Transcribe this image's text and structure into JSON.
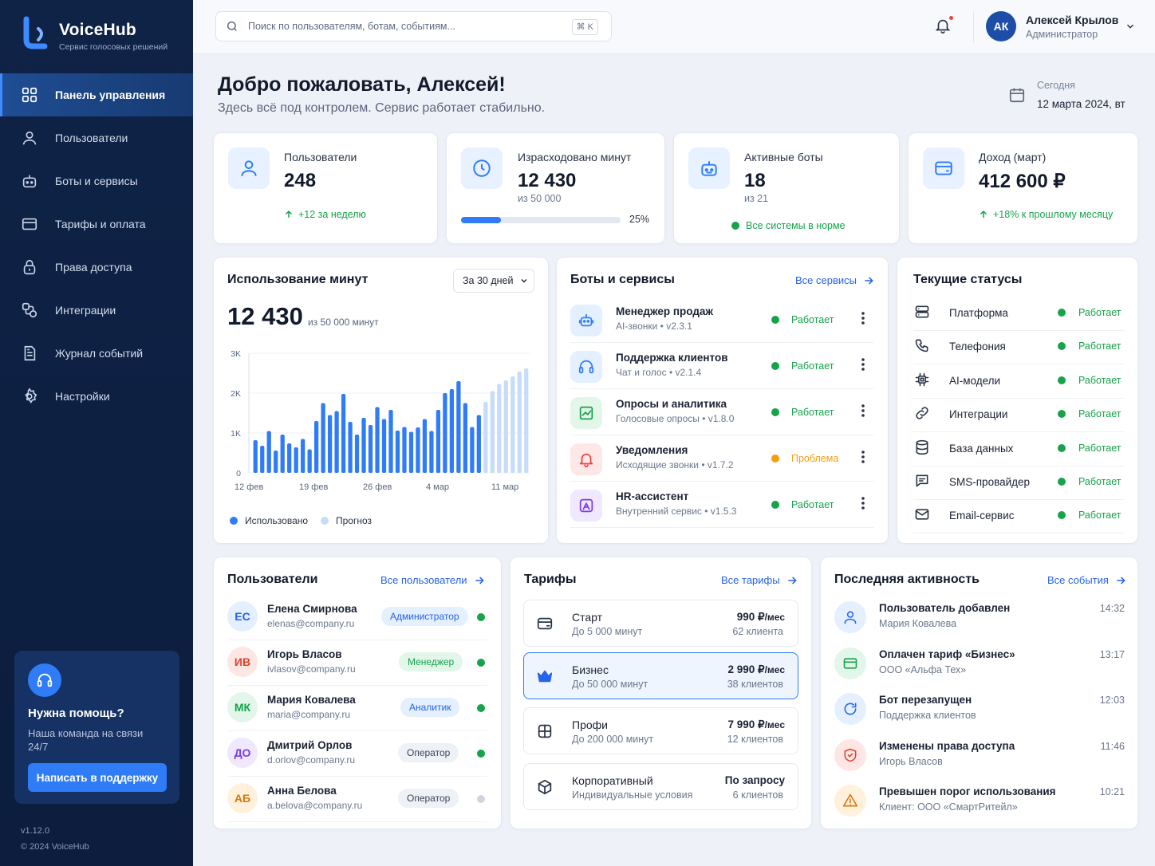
{
  "brand": {
    "name": "VoiceHub",
    "tagline": "Сервис голосовых решений"
  },
  "sidebar": {
    "items": [
      {
        "label": "Панель управления",
        "icon": "dashboard-icon",
        "active": true
      },
      {
        "label": "Пользователи",
        "icon": "user-icon"
      },
      {
        "label": "Боты и сервисы",
        "icon": "bot-icon"
      },
      {
        "label": "Тарифы и оплата",
        "icon": "card-icon"
      },
      {
        "label": "Права доступа",
        "icon": "lock-icon"
      },
      {
        "label": "Интеграции",
        "icon": "integrations-icon"
      },
      {
        "label": "Журнал событий",
        "icon": "document-icon"
      },
      {
        "label": "Настройки",
        "icon": "gear-icon"
      }
    ],
    "help": {
      "title": "Нужна помощь?",
      "text": "Наша команда на связи 24/7",
      "button": "Написать в поддержку"
    },
    "version": "v1.12.0",
    "copyright": "© 2024 VoiceHub"
  },
  "topbar": {
    "search_placeholder": "Поиск по пользователям, ботам, событиям...",
    "search_shortcut": "⌘ K",
    "user": {
      "initials": "АК",
      "name": "Алексей Крылов",
      "role": "Администратор"
    }
  },
  "header": {
    "title": "Добро пожаловать, Алексей!",
    "subtitle": "Здесь всё под контролем. Сервис работает стабильно.",
    "date_label": "Сегодня",
    "date_value": "12 марта 2024, вт"
  },
  "kpis": {
    "users": {
      "label": "Пользователи",
      "value": "248",
      "delta": "+12 за неделю"
    },
    "minutes": {
      "label": "Израсходовано минут",
      "value": "12 430",
      "sub": "из 50 000",
      "percent": "25%",
      "fraction": 0.25
    },
    "bots": {
      "label": "Активные боты",
      "value": "18",
      "sub": "из 21",
      "status": "Все системы в норме"
    },
    "revenue": {
      "label": "Доход (март)",
      "value": "412 600 ₽",
      "delta": "+18% к прошлому месяцу"
    }
  },
  "usage": {
    "title": "Использование минут",
    "period": "За 30 дней",
    "value": "12 430",
    "sub": "из 50 000 минут",
    "legend_used": "Использовано",
    "legend_forecast": "Прогноз"
  },
  "chart_data": {
    "type": "bar",
    "y_ticks": [
      "0",
      "1K",
      "2K",
      "3K"
    ],
    "ylim": [
      0,
      3000
    ],
    "x_ticks": [
      "12 фев",
      "19 фев",
      "26 фев",
      "4 мар",
      "11 мар"
    ],
    "series": [
      {
        "name": "Использовано",
        "color": "#2f7cf6",
        "values": [
          820,
          680,
          1050,
          560,
          960,
          740,
          640,
          850,
          590,
          1300,
          1750,
          1450,
          1550,
          1980,
          1280,
          960,
          1380,
          1200,
          1650,
          1350,
          1580,
          1060,
          1150,
          1030,
          1140,
          1350,
          1050,
          1580,
          2000,
          2100,
          2300,
          1750,
          1150,
          1450
        ]
      },
      {
        "name": "Прогноз",
        "color": "#c6dcfa",
        "values": [
          1780,
          2050,
          2230,
          2320,
          2420,
          2540,
          2620
        ]
      }
    ]
  },
  "bots": {
    "title": "Боты и сервисы",
    "link": "Все сервисы",
    "items": [
      {
        "name": "Менеджер продаж",
        "sub": "AI-звонки • v2.3.1",
        "status": "Работает",
        "ok": true,
        "icon": "robot-icon",
        "bg": "#e4f0ff",
        "fg": "#2f7cf6"
      },
      {
        "name": "Поддержка клиентов",
        "sub": "Чат и голос • v2.1.4",
        "status": "Работает",
        "ok": true,
        "icon": "headset-icon",
        "bg": "#e4f0ff",
        "fg": "#2f7cf6"
      },
      {
        "name": "Опросы и аналитика",
        "sub": "Голосовые опросы • v1.8.0",
        "status": "Работает",
        "ok": true,
        "icon": "chart-icon",
        "bg": "#e2f6ea",
        "fg": "#16a34a"
      },
      {
        "name": "Уведомления",
        "sub": "Исходящие звонки • v1.7.2",
        "status": "Проблема",
        "ok": false,
        "icon": "bell-icon",
        "bg": "#fde7e7",
        "fg": "#ef4444"
      },
      {
        "name": "HR-ассистент",
        "sub": "Внутренний сервис • v1.5.3",
        "status": "Работает",
        "ok": true,
        "icon": "hr-icon",
        "bg": "#efe8ff",
        "fg": "#7c3aed"
      }
    ]
  },
  "statuses": {
    "title": "Текущие статусы",
    "items": [
      {
        "name": "Платформа",
        "status": "Работает",
        "icon": "server-icon"
      },
      {
        "name": "Телефония",
        "status": "Работает",
        "icon": "phone-icon"
      },
      {
        "name": "AI-модели",
        "status": "Работает",
        "icon": "chip-icon"
      },
      {
        "name": "Интеграции",
        "status": "Работает",
        "icon": "link-icon"
      },
      {
        "name": "База данных",
        "status": "Работает",
        "icon": "database-icon"
      },
      {
        "name": "SMS-провайдер",
        "status": "Работает",
        "icon": "message-icon"
      },
      {
        "name": "Email-сервис",
        "status": "Работает",
        "icon": "mail-icon"
      }
    ]
  },
  "users": {
    "title": "Пользователи",
    "link": "Все пользователи",
    "items": [
      {
        "initials": "ЕС",
        "name": "Елена Смирнова",
        "email": "elenas@company.ru",
        "role": "Администратор",
        "online": true,
        "av_bg": "#e4efff",
        "av_fg": "#2563eb",
        "role_bg": "#e4efff",
        "role_fg": "#2563eb"
      },
      {
        "initials": "ИВ",
        "name": "Игорь Власов",
        "email": "ivlasov@company.ru",
        "role": "Менеджер",
        "online": true,
        "av_bg": "#fde6e3",
        "av_fg": "#e0412f",
        "role_bg": "#e2f6ea",
        "role_fg": "#16a34a"
      },
      {
        "initials": "МК",
        "name": "Мария Ковалева",
        "email": "maria@company.ru",
        "role": "Аналитик",
        "online": true,
        "av_bg": "#e2f6ea",
        "av_fg": "#16a34a",
        "role_bg": "#e4efff",
        "role_fg": "#2563eb"
      },
      {
        "initials": "ДО",
        "name": "Дмитрий Орлов",
        "email": "d.orlov@company.ru",
        "role": "Оператор",
        "online": true,
        "av_bg": "#efe8ff",
        "av_fg": "#7c3aed",
        "role_bg": "#eef1f5",
        "role_fg": "#3b4558"
      },
      {
        "initials": "АБ",
        "name": "Анна Белова",
        "email": "a.belova@company.ru",
        "role": "Оператор",
        "online": false,
        "av_bg": "#fff1dc",
        "av_fg": "#d97706",
        "role_bg": "#eef1f5",
        "role_fg": "#3b4558"
      }
    ]
  },
  "plans": {
    "title": "Тарифы",
    "link": "Все тарифы",
    "items": [
      {
        "name": "Старт",
        "sub": "До 5 000 минут",
        "price": "990 ₽",
        "per": "/мес",
        "count": "62 клиента",
        "icon": "wallet-icon"
      },
      {
        "name": "Бизнес",
        "sub": "До 50 000 минут",
        "price": "2 990 ₽",
        "per": "/мес",
        "count": "38 клиентов",
        "icon": "crown-icon",
        "selected": true
      },
      {
        "name": "Профи",
        "sub": "До 200 000 минут",
        "price": "7 990 ₽",
        "per": "/мес",
        "count": "12 клиентов",
        "icon": "grid-icon"
      },
      {
        "name": "Корпоративный",
        "sub": "Индивидуальные условия",
        "price": "По запросу",
        "per": "",
        "count": "6 клиентов",
        "icon": "cube-icon"
      }
    ]
  },
  "activity": {
    "title": "Последняя активность",
    "link": "Все события",
    "items": [
      {
        "title": "Пользователь добавлен",
        "sub": "Мария Ковалева",
        "time": "14:32",
        "icon": "user-add-icon",
        "bg": "#e4efff",
        "fg": "#2563eb"
      },
      {
        "title": "Оплачен тариф «Бизнес»",
        "sub": "ООО «Альфа Тех»",
        "time": "13:17",
        "icon": "card-icon",
        "bg": "#e2f6ea",
        "fg": "#16a34a"
      },
      {
        "title": "Бот перезапущен",
        "sub": "Поддержка клиентов",
        "time": "12:03",
        "icon": "refresh-icon",
        "bg": "#e4efff",
        "fg": "#2563eb"
      },
      {
        "title": "Изменены права доступа",
        "sub": "Игорь Власов",
        "time": "11:46",
        "icon": "shield-icon",
        "bg": "#fde6e3",
        "fg": "#e0412f"
      },
      {
        "title": "Превышен порог использования",
        "sub": "Клиент: ООО «СмартРитейл»",
        "time": "10:21",
        "icon": "warning-icon",
        "bg": "#fff1dc",
        "fg": "#d97706"
      }
    ]
  }
}
